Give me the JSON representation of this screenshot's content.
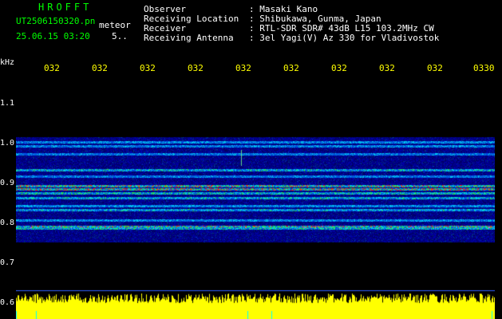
{
  "header": {
    "title": "HROFFT",
    "file_name": "UT2506150320.pn",
    "file_suffix": "meteor",
    "date_time": "25.06.15 03:20",
    "duration": "5..",
    "rows": [
      {
        "label": "Observer",
        "value": ": Masaki Kano"
      },
      {
        "label": "Receiving Location",
        "value": ": Shibukawa, Gunma, Japan"
      },
      {
        "label": "Receiver",
        "value": ": RTL-SDR SDR# 43dB L15 103.2MHz CW"
      },
      {
        "label": "Receiving Antenna",
        "value": ": 3el Yagi(V) Az 330 for Vladivostok"
      }
    ]
  },
  "axes": {
    "y_unit": "kHz",
    "y_ticks": [
      "1.1",
      "1.0",
      "0.9",
      "0.8",
      "0.7",
      "0.6"
    ],
    "x_ticks": [
      "032",
      "032",
      "032",
      "032",
      "032",
      "032",
      "032",
      "032",
      "032",
      "0330"
    ]
  },
  "colors": {
    "header_green": "#00ff00",
    "text_white": "#ffffff",
    "time_yellow": "#ffff00",
    "background": "#000000",
    "plot_bg": "#020033",
    "signal_red": "#ff2020",
    "signal_cyan": "#00e0ff"
  }
}
